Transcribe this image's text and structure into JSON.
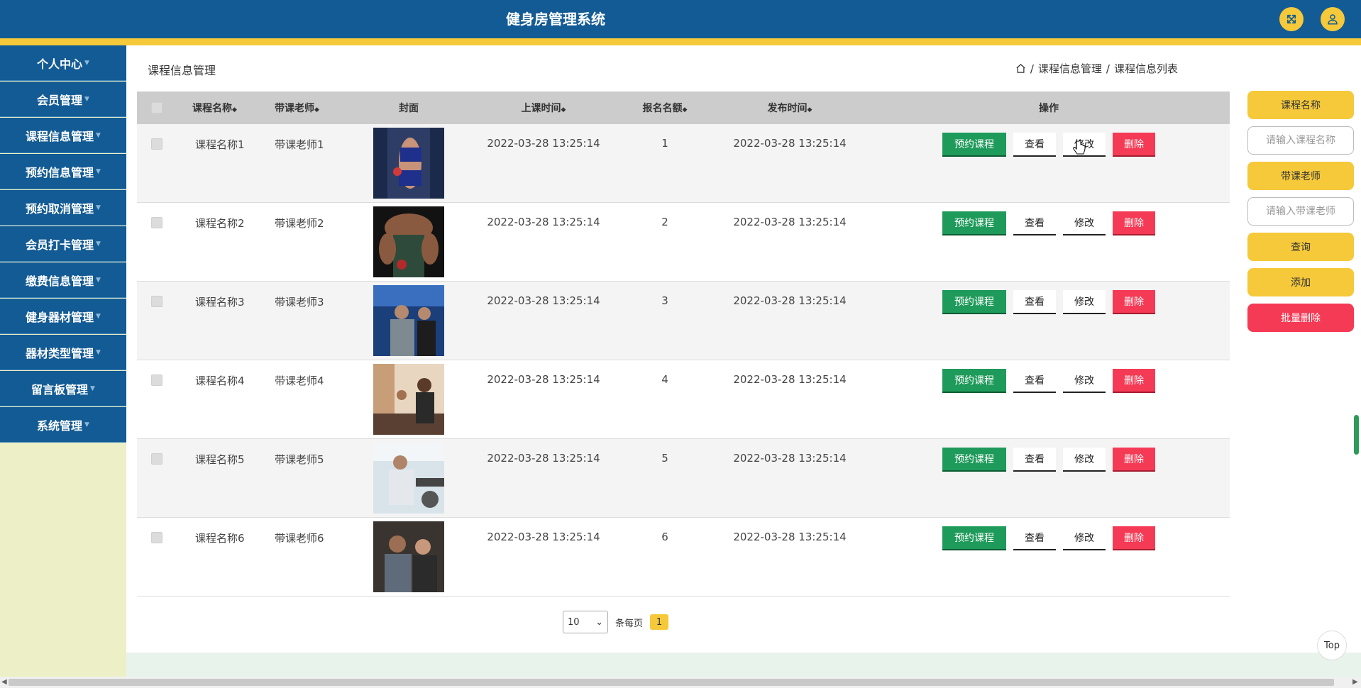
{
  "header": {
    "title": "健身房管理系统"
  },
  "sidebar": {
    "items": [
      {
        "label": "个人中心"
      },
      {
        "label": "会员管理"
      },
      {
        "label": "课程信息管理"
      },
      {
        "label": "预约信息管理"
      },
      {
        "label": "预约取消管理"
      },
      {
        "label": "会员打卡管理"
      },
      {
        "label": "缴费信息管理"
      },
      {
        "label": "健身器材管理"
      },
      {
        "label": "器材类型管理"
      },
      {
        "label": "留言板管理"
      },
      {
        "label": "系统管理"
      }
    ]
  },
  "page": {
    "title": "课程信息管理",
    "breadcrumb": [
      "课程信息管理",
      "课程信息列表"
    ],
    "breadcrumb_sep": "/"
  },
  "table": {
    "headers": {
      "name": "课程名称",
      "teacher": "带课老师",
      "cover": "封面",
      "time": "上课时间",
      "quota": "报名名额",
      "published": "发布时间",
      "ops": "操作"
    },
    "rows": [
      {
        "name": "课程名称1",
        "teacher": "带课老师1",
        "time": "2022-03-28 13:25:14",
        "quota": "1",
        "published": "2022-03-28 13:25:14"
      },
      {
        "name": "课程名称2",
        "teacher": "带课老师2",
        "time": "2022-03-28 13:25:14",
        "quota": "2",
        "published": "2022-03-28 13:25:14"
      },
      {
        "name": "课程名称3",
        "teacher": "带课老师3",
        "time": "2022-03-28 13:25:14",
        "quota": "3",
        "published": "2022-03-28 13:25:14"
      },
      {
        "name": "课程名称4",
        "teacher": "带课老师4",
        "time": "2022-03-28 13:25:14",
        "quota": "4",
        "published": "2022-03-28 13:25:14"
      },
      {
        "name": "课程名称5",
        "teacher": "带课老师5",
        "time": "2022-03-28 13:25:14",
        "quota": "5",
        "published": "2022-03-28 13:25:14"
      },
      {
        "name": "课程名称6",
        "teacher": "带课老师6",
        "time": "2022-03-28 13:25:14",
        "quota": "6",
        "published": "2022-03-28 13:25:14"
      }
    ],
    "ops": {
      "book": "预约课程",
      "view": "查看",
      "edit": "修改",
      "delete": "删除"
    }
  },
  "pager": {
    "page_size": "10",
    "per_page_label": "条每页",
    "current_page": "1"
  },
  "search": {
    "name_label": "课程名称",
    "name_placeholder": "请输入课程名称",
    "teacher_label": "带课老师",
    "teacher_placeholder": "请输入带课老师",
    "query": "查询",
    "add": "添加",
    "batch_delete": "批量删除"
  },
  "top_button": "Top",
  "colors": {
    "primary": "#135b94",
    "accent": "#f5c93a",
    "success": "#1e9a5a",
    "danger": "#f53a55"
  }
}
